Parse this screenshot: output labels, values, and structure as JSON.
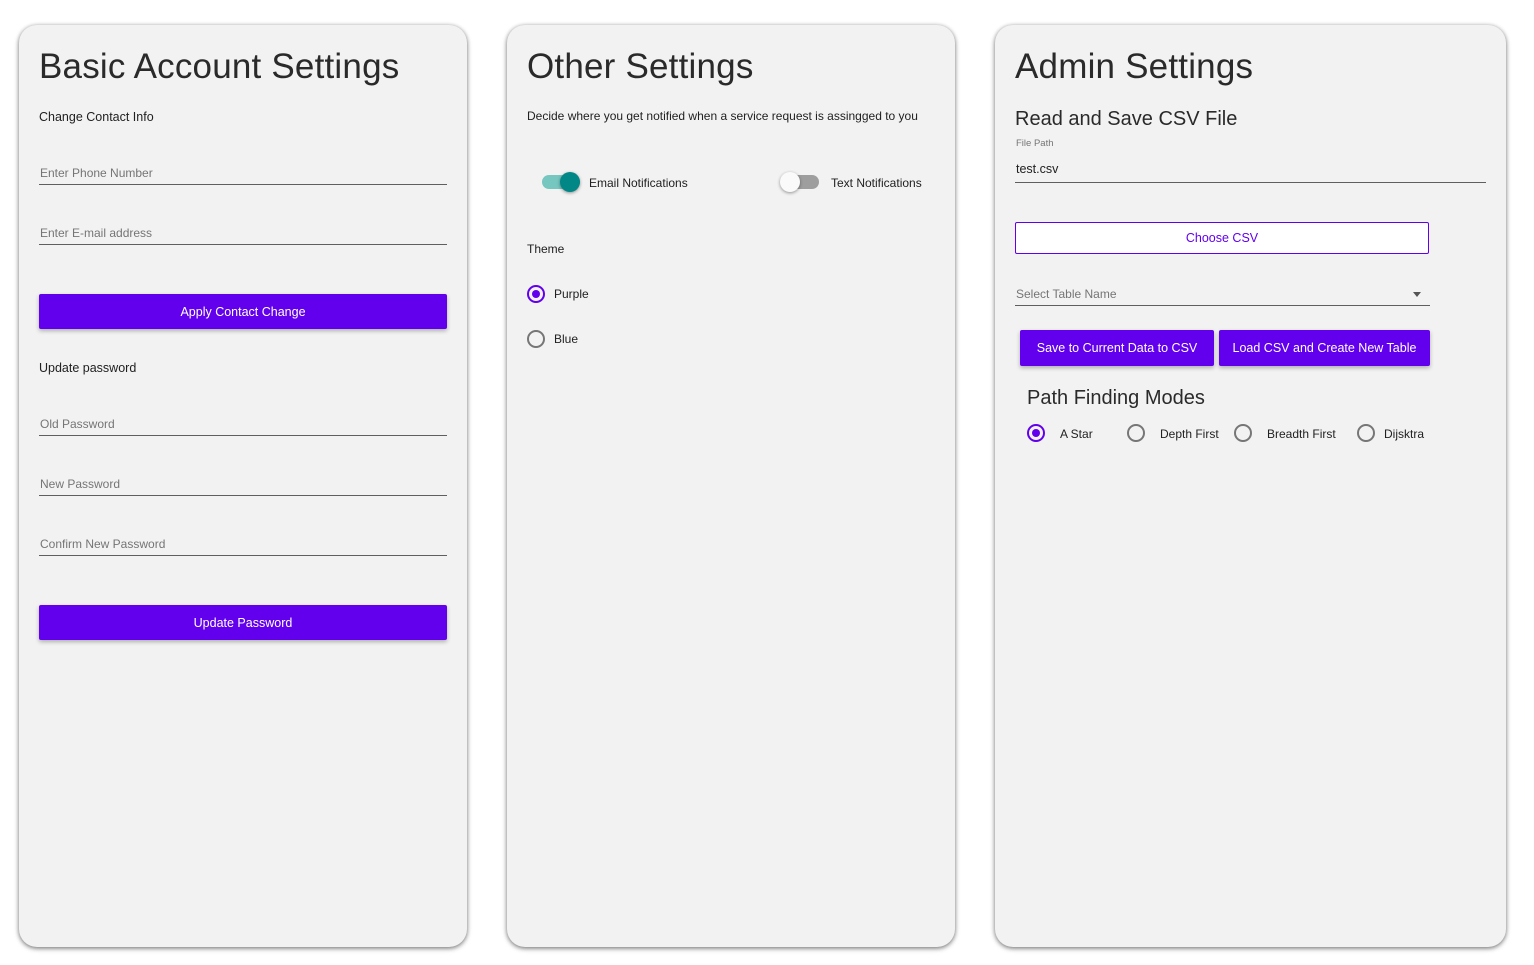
{
  "basic": {
    "title": "Basic Account Settings",
    "contact_section": "Change Contact Info",
    "phone_placeholder": "Enter Phone Number",
    "email_placeholder": "Enter E-mail address",
    "apply_button": "Apply Contact Change",
    "password_section": "Update password",
    "old_password_placeholder": "Old Password",
    "new_password_placeholder": "New Password",
    "confirm_password_placeholder": "Confirm New Password",
    "update_button": "Update Password"
  },
  "other": {
    "title": "Other Settings",
    "notify_description": "Decide where you get notified when a service request is assingged to you",
    "email_toggle": {
      "label": "Email Notifications",
      "on": true
    },
    "text_toggle": {
      "label": "Text Notifications",
      "on": false
    },
    "theme_label": "Theme",
    "theme_options": [
      {
        "label": "Purple",
        "checked": true
      },
      {
        "label": "Blue",
        "checked": false
      }
    ]
  },
  "admin": {
    "title": "Admin Settings",
    "csv_heading": "Read and Save CSV File",
    "file_path_label": "File Path",
    "file_path_value": "test.csv",
    "choose_csv_button": "Choose CSV",
    "table_select_placeholder": "Select Table Name",
    "save_button": "Save to Current Data to CSV",
    "load_button": "Load CSV and Create New Table",
    "path_heading": "Path Finding Modes",
    "path_modes": [
      {
        "label": "A Star",
        "checked": true
      },
      {
        "label": "Depth First",
        "checked": false
      },
      {
        "label": "Breadth First",
        "checked": false
      },
      {
        "label": "Dijsktra",
        "checked": false
      }
    ]
  },
  "colors": {
    "primary": "#6200ee",
    "toggle_on": "#018786",
    "card_background": "#f2f2f2"
  }
}
